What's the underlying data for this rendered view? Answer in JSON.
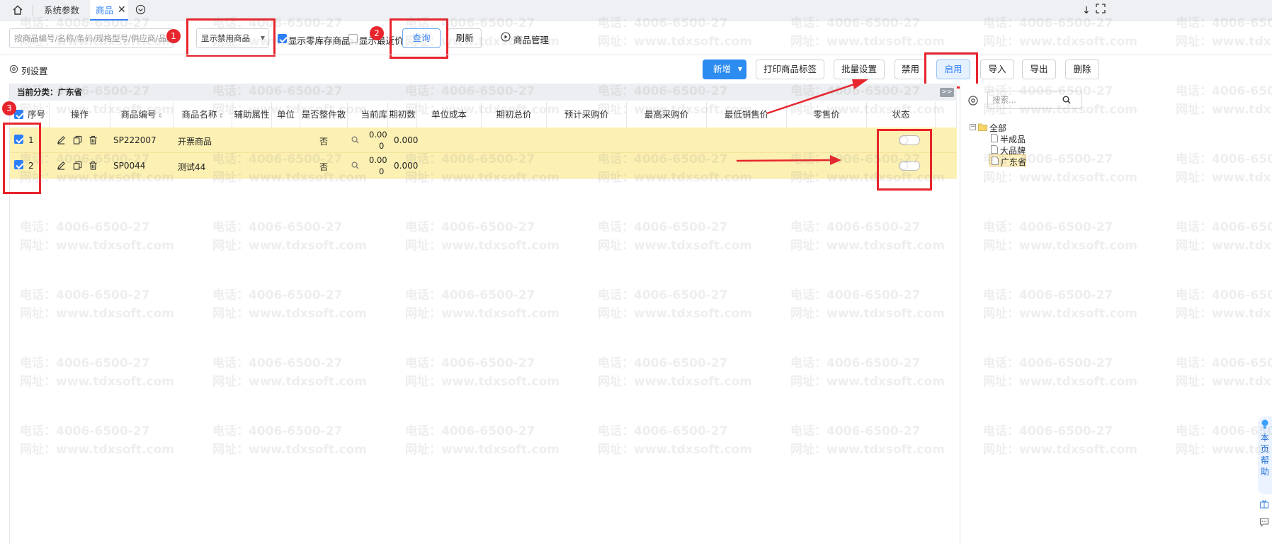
{
  "tabs": {
    "home_icon": "home-icon",
    "items": [
      {
        "label": "系统参数"
      },
      {
        "label": "商品"
      }
    ]
  },
  "toolbar": {
    "search_placeholder": "按商品编号/名称/条码/规格型号/供应商/品牌查",
    "filter_select": "显示禁用商品",
    "show_zero_stock": "显示零库存商品",
    "show_recent_price": "显示最近价",
    "query": "查询",
    "refresh": "刷新",
    "manage": "商品管理"
  },
  "actions": {
    "col_settings": "列设置",
    "add": "新增",
    "print_labels": "打印商品标签",
    "batch_set": "批量设置",
    "disable": "禁用",
    "enable": "启用",
    "import": "导入",
    "export": "导出",
    "delete": "删除"
  },
  "grid": {
    "category_label": "当前分类：广东省",
    "headers": [
      "序号",
      "操作",
      "商品编号",
      "商品名称",
      "辅助属性",
      "单位",
      "是否整件散",
      "当前库",
      "期初数",
      "单位成本",
      "期初总价",
      "预计采购价",
      "最高采购价",
      "最低销售价",
      "零售价",
      "状态"
    ],
    "rows": [
      {
        "seq": "1",
        "code": "SP222007",
        "name": "开票商品",
        "whole": "否",
        "stock_a": "0.00",
        "stock_b": "0",
        "initial": "0.000"
      },
      {
        "seq": "2",
        "code": "SP0044",
        "name": "测试44",
        "whole": "否",
        "stock_a": "0.00",
        "stock_b": "0",
        "initial": "0.000"
      }
    ]
  },
  "tree": {
    "search_placeholder": "搜索...",
    "expand_label": ">>",
    "root": "全部",
    "children": [
      "半成品",
      "大品牌",
      "广东省"
    ],
    "selected": "广东省"
  },
  "annotations": {
    "badges": [
      "1",
      "2",
      "3"
    ]
  },
  "help": {
    "label": "本页帮助"
  },
  "watermark": {
    "phone": "电话：4006-6500-27",
    "site": "网址：www.tdxsoft.com"
  },
  "colors": {
    "accent": "#2d7ff9",
    "highlight": "#e8242c",
    "selected_row": "#fcf0b3"
  }
}
